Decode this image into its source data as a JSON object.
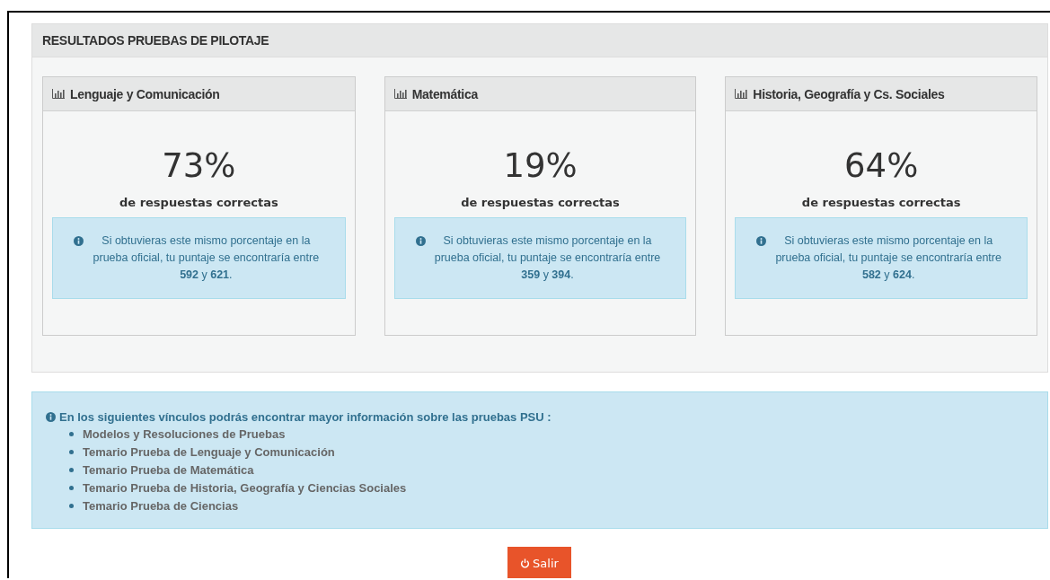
{
  "panel": {
    "title": "RESULTADOS PRUEBAS DE PILOTAJE"
  },
  "subjects": [
    {
      "name": "Lenguaje y Comunicación",
      "percentage": "73%",
      "caption": "de respuestas correctas",
      "note": "Si obtuvieras este mismo porcentaje en la prueba oficial, tu puntaje se encontraría entre **592** y **621**."
    },
    {
      "name": "Matemática",
      "percentage": "19%",
      "caption": "de respuestas correctas",
      "note": "Si obtuvieras este mismo porcentaje en la prueba oficial, tu puntaje se encontraría entre **359** y **394**."
    },
    {
      "name": "Historia, Geografía y Cs. Sociales",
      "percentage": "64%",
      "caption": "de respuestas correctas",
      "note": "Si obtuvieras este mismo porcentaje en la prueba oficial, tu puntaje se encontraría entre **582** y **624**."
    }
  ],
  "links_box": {
    "intro": "En los siguientes vínculos podrás encontrar mayor información sobre las pruebas PSU :",
    "links": [
      "Modelos y Resoluciones de Pruebas",
      "Temario Prueba de Lenguaje y Comunicación",
      "Temario Prueba de Matemática",
      "Temario Prueba de Historia, Geografía y Ciencias Sociales",
      "Temario Prueba de Ciencias"
    ]
  },
  "exit_button": {
    "label": "Salir"
  }
}
